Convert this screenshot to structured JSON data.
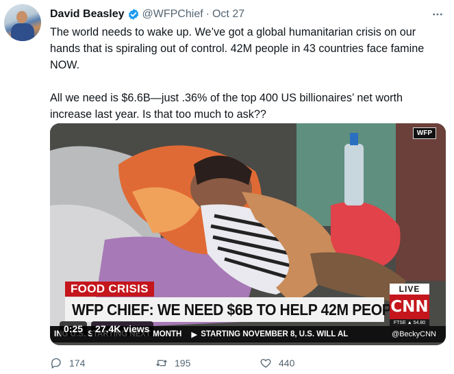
{
  "author": {
    "name": "David Beasley",
    "handle": "@WFPChief",
    "separator": "·",
    "date": "Oct 27"
  },
  "tweet": {
    "text": "The world needs to wake up. We’ve got a global humanitarian crisis on our hands that is spiraling out of control. 42M people in 43 countries face famine NOW.\n\nAll we need is $6.6B—just .36% of the top 400 US billionaires’ net worth increase last year. Is that too much to ask??"
  },
  "media": {
    "logo": "WFP",
    "tag": "FOOD CRISIS",
    "headline": "WFP CHIEF: WE NEED $6B TO HELP 42M PEOPLE",
    "live": "LIVE",
    "network": "CNN",
    "market": "FTSE ▲ 54.80",
    "ticker_left": "ING U.S. STARTING NEXT MONTH",
    "ticker_right": "STARTING NOVEMBER 8, U.S. WILL AL",
    "ticker_handle": "@BeckyCNN",
    "duration": "0:25",
    "views": "27.4K views"
  },
  "actions": {
    "replies": "174",
    "retweets": "195",
    "likes": "440"
  },
  "colors": {
    "text": "#0f1419",
    "secondary": "#536471",
    "verified": "#1d9bf0",
    "cnn_red": "#c4161c"
  },
  "icons": [
    "verified-badge-icon",
    "more-icon",
    "reply-icon",
    "retweet-icon",
    "like-icon"
  ]
}
